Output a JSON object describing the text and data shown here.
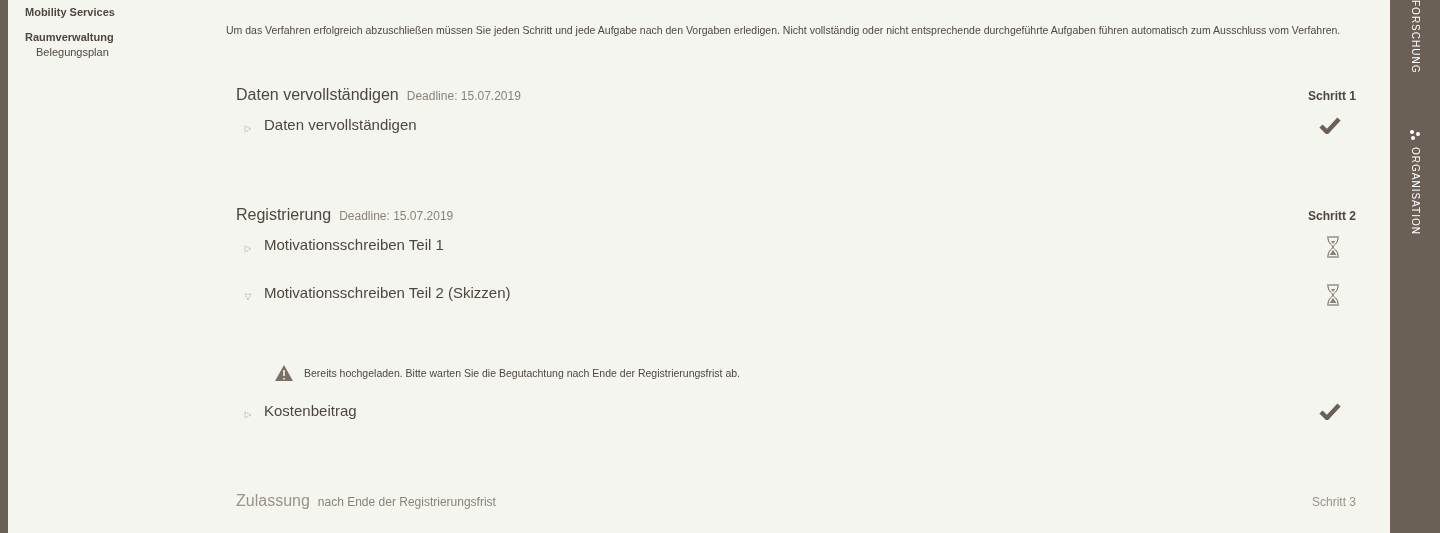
{
  "sidebar": {
    "items": [
      {
        "label": "Mobility Services",
        "kind": "heading"
      },
      {
        "label": "Raumverwaltung",
        "kind": "heading"
      },
      {
        "label": "Belegungsplan",
        "kind": "link"
      }
    ]
  },
  "intro": "Um das Verfahren erfolgreich abzuschließen müssen Sie jeden Schritt und jede Aufgabe nach den Vorgaben erledigen. Nicht vollständig oder nicht entsprechende durchgeführte Aufgaben führen automatisch zum Ausschluss vom Verfahren.",
  "steps": [
    {
      "title": "Daten vervollständigen",
      "subtitle": "Deadline: 15.07.2019",
      "step": "Schritt 1",
      "disabled": false,
      "tasks": [
        {
          "title": "Daten vervollständigen",
          "expanded": false,
          "kind": "done"
        }
      ]
    },
    {
      "title": "Registrierung",
      "subtitle": "Deadline: 15.07.2019",
      "step": "Schritt 2",
      "disabled": false,
      "tasks": [
        {
          "title": "Motivationsschreiben Teil 1",
          "expanded": false,
          "kind": "pending"
        },
        {
          "title": "Motivationsschreiben Teil 2 (Skizzen)",
          "expanded": true,
          "kind": "pending",
          "message": "Bereits hochgeladen. Bitte warten Sie die Begutachtung nach Ende der Registrierungsfrist ab."
        },
        {
          "title": "Kostenbeitrag",
          "expanded": false,
          "kind": "done"
        }
      ]
    },
    {
      "title": "Zulassung",
      "subtitle": "nach Ende der Registrierungsfrist",
      "step": "Schritt 3",
      "disabled": true
    }
  ],
  "right_bar": {
    "items": [
      {
        "label": "FORSCHUNG",
        "kind": "text"
      },
      {
        "label": "ORGANISATION",
        "kind": "icon"
      }
    ]
  }
}
